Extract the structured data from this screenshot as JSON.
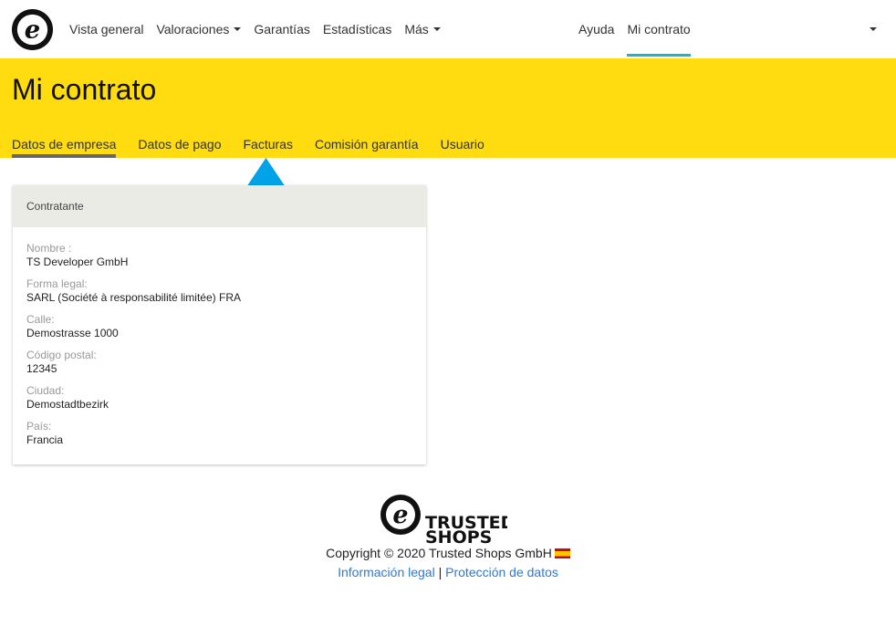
{
  "nav": {
    "items": [
      {
        "label": "Vista general",
        "dropdown": false
      },
      {
        "label": "Valoraciones",
        "dropdown": true
      },
      {
        "label": "Garantías",
        "dropdown": false
      },
      {
        "label": "Estadísticas",
        "dropdown": false
      },
      {
        "label": "Más",
        "dropdown": true
      }
    ],
    "help_label": "Ayuda",
    "contract_label": "Mi contrato",
    "accent_color": "#1fb5c8"
  },
  "header": {
    "title": "Mi contrato",
    "background": "#ffdc0f",
    "tabs": [
      {
        "label": "Datos de empresa",
        "active": true
      },
      {
        "label": "Datos de pago",
        "active": false
      },
      {
        "label": "Facturas",
        "active": false
      },
      {
        "label": "Comisión garantía",
        "active": false
      },
      {
        "label": "Usuario",
        "active": false
      }
    ]
  },
  "annotation": {
    "icon": "up-arrow-icon",
    "color": "#00a2e8"
  },
  "card": {
    "title": "Contratante",
    "fields": [
      {
        "label": "Nombre :",
        "value": "TS Developer GmbH"
      },
      {
        "label": "Forma legal:",
        "value": "SARL (Société à responsabilité limitée) FRA"
      },
      {
        "label": "Calle:",
        "value": "Demostrasse 1000"
      },
      {
        "label": "Código postal:",
        "value": "12345"
      },
      {
        "label": "Ciudad:",
        "value": "Demostadtbezirk"
      },
      {
        "label": "País:",
        "value": "Francia"
      }
    ]
  },
  "footer": {
    "logo_text_1": "TRUSTED",
    "logo_text_2": "SHOPS",
    "copyright": "Copyright © 2020 Trusted Shops GmbH",
    "flag_icon": "spain-flag-icon",
    "link_legal": "Información legal",
    "separator": "|",
    "link_privacy": "Protección de datos"
  }
}
